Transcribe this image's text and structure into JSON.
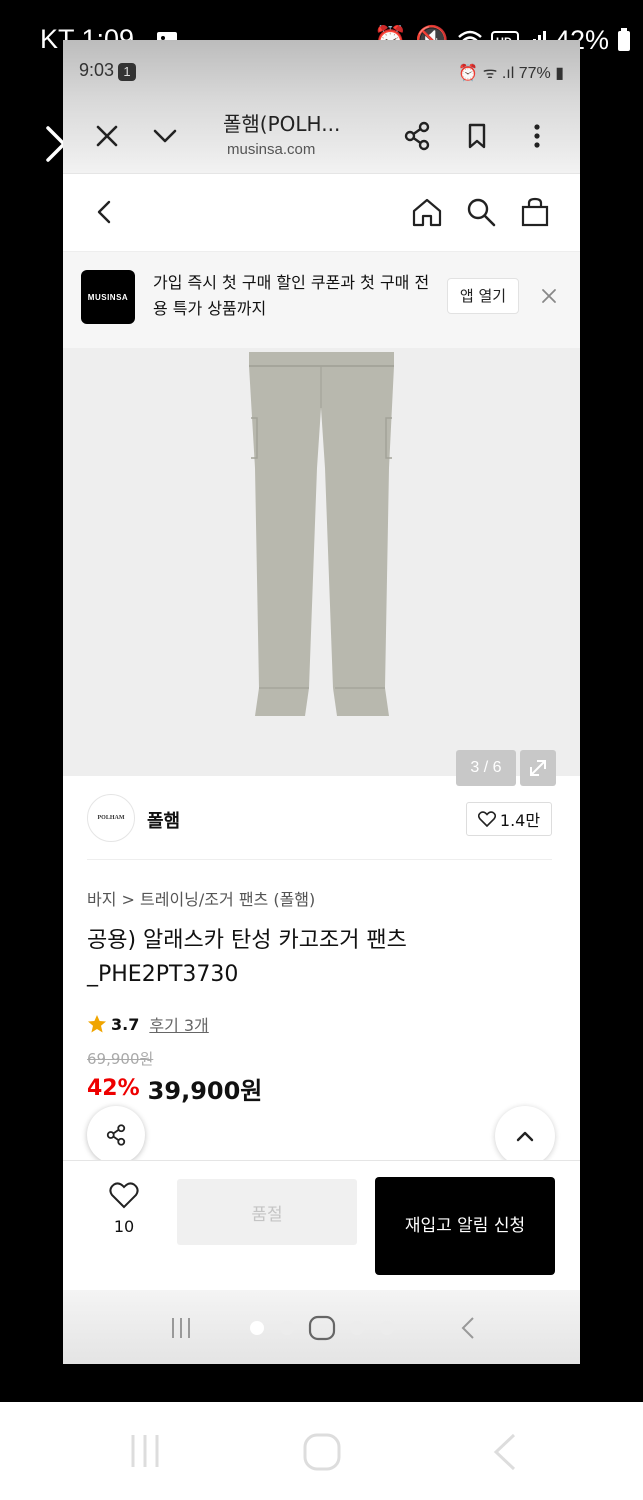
{
  "outer_status": {
    "carrier_time": "KT 1:09",
    "battery": "42%"
  },
  "inner_status": {
    "time": "9:03",
    "badge": "1",
    "battery": "77%"
  },
  "browser": {
    "title": "폴햄(POLH...",
    "url": "musinsa.com"
  },
  "banner": {
    "logo": "MUSINSA",
    "text": "가입 즉시 첫 구매 할인 쿠폰과 첫 구매 전용 특가 상품까지",
    "button": "앱 열기"
  },
  "gallery": {
    "counter": "3 / 6",
    "product_color": "#b8b8ae"
  },
  "brand": {
    "logo": "POLHAM",
    "name": "폴햄",
    "likes": "1.4만"
  },
  "product": {
    "breadcrumb": "바지 > 트레이닝/조거 팬츠 (폴햄)",
    "title": "공용) 알래스카 탄성 카고조거 팬츠_PHE2PT3730",
    "rating": "3.7",
    "reviews": "후기 3개",
    "original_price": "69,900원",
    "discount": "42%",
    "price": "39,900원"
  },
  "bottom": {
    "wish_count": "10",
    "soldout": "품절",
    "restock": "재입고 알림 신청"
  }
}
